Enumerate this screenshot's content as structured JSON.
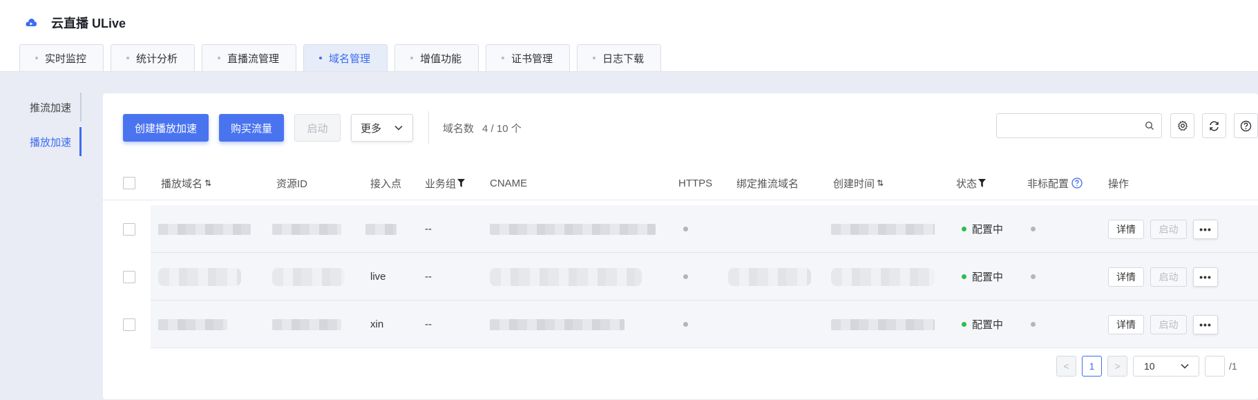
{
  "app": {
    "title": "云直播 ULive"
  },
  "tabs": [
    {
      "label": "实时监控"
    },
    {
      "label": "统计分析"
    },
    {
      "label": "直播流管理"
    },
    {
      "label": "域名管理",
      "active": true
    },
    {
      "label": "增值功能"
    },
    {
      "label": "证书管理"
    },
    {
      "label": "日志下载"
    }
  ],
  "sidebar": {
    "items": [
      {
        "label": "推流加速"
      },
      {
        "label": "播放加速",
        "active": true
      }
    ]
  },
  "toolbar": {
    "create_label": "创建播放加速",
    "buy_label": "购买流量",
    "start_label": "启动",
    "more_label": "更多",
    "count_label": "域名数",
    "count_value": "4 / 10 个"
  },
  "search": {
    "placeholder": ""
  },
  "table": {
    "headers": {
      "domain": "播放域名",
      "resource_id": "资源ID",
      "access": "接入点",
      "group": "业务组",
      "cname": "CNAME",
      "https": "HTTPS",
      "push_domain": "绑定推流域名",
      "created": "创建时间",
      "status": "状态",
      "nonstd": "非标配置",
      "ops": "操作"
    },
    "rows": [
      {
        "access": "",
        "group": "--",
        "status": "配置中",
        "detail": "详情",
        "start": "启动",
        "more": "•••"
      },
      {
        "access": "live",
        "group": "--",
        "status": "配置中",
        "detail": "详情",
        "start": "启动",
        "more": "•••"
      },
      {
        "access": "xin",
        "group": "--",
        "status": "配置中",
        "detail": "详情",
        "start": "启动",
        "more": "•••"
      }
    ]
  },
  "pagination": {
    "prev": "<",
    "current": "1",
    "next": ">",
    "page_size": "10",
    "jump_value": "",
    "total_pages": "/1"
  },
  "colors": {
    "primary": "#4a74ef",
    "active_tab_bg": "#e6ecf8",
    "status_green": "#2fbd4f",
    "background": "#e9ecf5"
  }
}
